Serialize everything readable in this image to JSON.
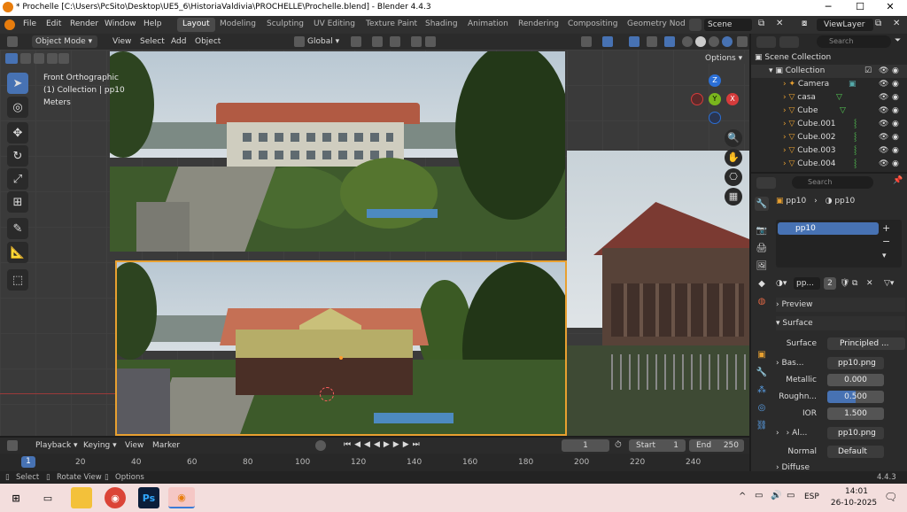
{
  "window": {
    "title": "* Prochelle [C:\\Users\\PcSito\\Desktop\\UE5_6\\HistoriaValdivia\\PROCHELLE\\Prochelle.blend] - Blender 4.4.3"
  },
  "menu": [
    "File",
    "Edit",
    "Render",
    "Window",
    "Help"
  ],
  "workspaces": [
    "Layout",
    "Modeling",
    "Sculpting",
    "UV Editing",
    "Texture Paint",
    "Shading",
    "Animation",
    "Rendering",
    "Compositing",
    "Geometry Nod"
  ],
  "scene": "Scene",
  "viewlayer": "ViewLayer",
  "viewport_header": {
    "mode": "Object Mode",
    "view": "View",
    "select": "Select",
    "add": "Add",
    "object": "Object",
    "orientation": "Global",
    "options": "Options"
  },
  "overlay_text": {
    "view_name": "Front Orthographic",
    "collection": "(1) Collection | pp10",
    "units": "Meters"
  },
  "gizmo": {
    "z": "Z",
    "y": "Y",
    "x": "X"
  },
  "outliner": {
    "search_placeholder": "Search",
    "items": [
      {
        "name": "Scene Collection",
        "indent": 0
      },
      {
        "name": "Collection",
        "indent": 1
      },
      {
        "name": "Camera",
        "indent": 2
      },
      {
        "name": "casa",
        "indent": 2
      },
      {
        "name": "Cube",
        "indent": 2
      },
      {
        "name": "Cube.001",
        "indent": 2
      },
      {
        "name": "Cube.002",
        "indent": 2
      },
      {
        "name": "Cube.003",
        "indent": 2
      },
      {
        "name": "Cube.004",
        "indent": 2
      }
    ]
  },
  "properties": {
    "search_placeholder": "Search",
    "breadcrumb_object": "pp10",
    "breadcrumb_material": "pp10",
    "slot": "pp10",
    "material_name": "pp...",
    "users": "2",
    "sections": {
      "preview": "Preview",
      "surface": "Surface",
      "diffuse": "Diffuse"
    },
    "rows": {
      "surface_label": "Surface",
      "surface_value": "Principled ...",
      "base_label": "Bas...",
      "base_value": "pp10.png",
      "metallic_label": "Metallic",
      "metallic_value": "0.000",
      "roughness_label": "Roughn...",
      "roughness_value": "0.500",
      "ior_label": "IOR",
      "ior_value": "1.500",
      "alpha_label": "Al...",
      "alpha_value": "pp10.png",
      "normal_label": "Normal",
      "normal_value": "Default"
    }
  },
  "timeline": {
    "playback": "Playback",
    "keying": "Keying",
    "view": "View",
    "marker": "Marker",
    "current_frame": "1",
    "start_label": "Start",
    "start": "1",
    "end_label": "End",
    "end": "250",
    "ruler": [
      "1",
      "20",
      "40",
      "60",
      "80",
      "100",
      "120",
      "140",
      "160",
      "180",
      "200",
      "220",
      "240"
    ]
  },
  "status": {
    "select": "Select",
    "rotate": "Rotate View",
    "options": "Options",
    "version": "4.4.3"
  },
  "taskbar": {
    "lang": "ESP",
    "time": "14:01",
    "date": "26-10-2025"
  },
  "colors": {
    "accent": "#4772b3",
    "selection_outline": "#e8a030",
    "blender_orange": "#e87d0d"
  }
}
